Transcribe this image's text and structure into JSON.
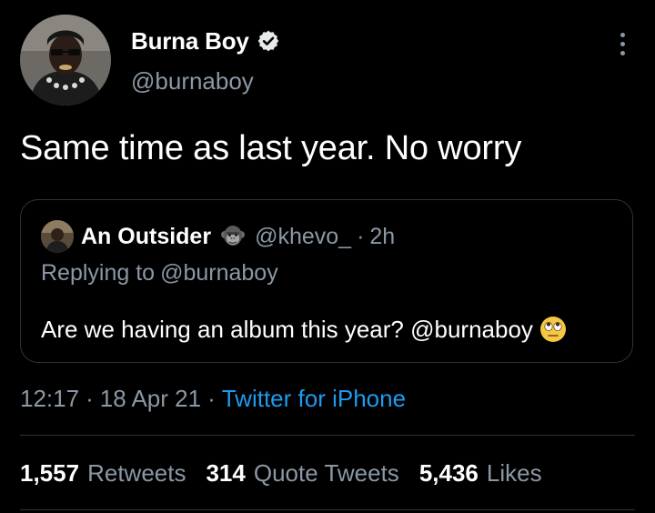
{
  "tweet": {
    "author": {
      "name": "Burna Boy",
      "handle": "@burnaboy",
      "verified_icon": "verified-badge-icon"
    },
    "text": "Same time as last year. No worry",
    "quoted_tweet": {
      "author_name": "An Outsider",
      "name_emoji_icon": "gorilla-emoji-icon",
      "handle": "@khevo_",
      "separator": "·",
      "time": "2h",
      "replying_prefix": "Replying to",
      "replying_handle": "@burnaboy",
      "text": "Are we having an album this year? @burnaboy",
      "text_emoji_icon": "face-with-rolling-eyes-emoji-icon"
    },
    "meta": {
      "time": "12:17",
      "separator": "·",
      "date": "18 Apr 21",
      "source": "Twitter for iPhone"
    },
    "stats": [
      {
        "value": "1,557",
        "label": "Retweets"
      },
      {
        "value": "314",
        "label": "Quote Tweets"
      },
      {
        "value": "5,436",
        "label": "Likes"
      }
    ]
  },
  "colors": {
    "background": "#000000",
    "primary_text": "#ffffff",
    "secondary_text": "#8b98a5",
    "link": "#1d9bf0",
    "border": "#2f3336"
  }
}
